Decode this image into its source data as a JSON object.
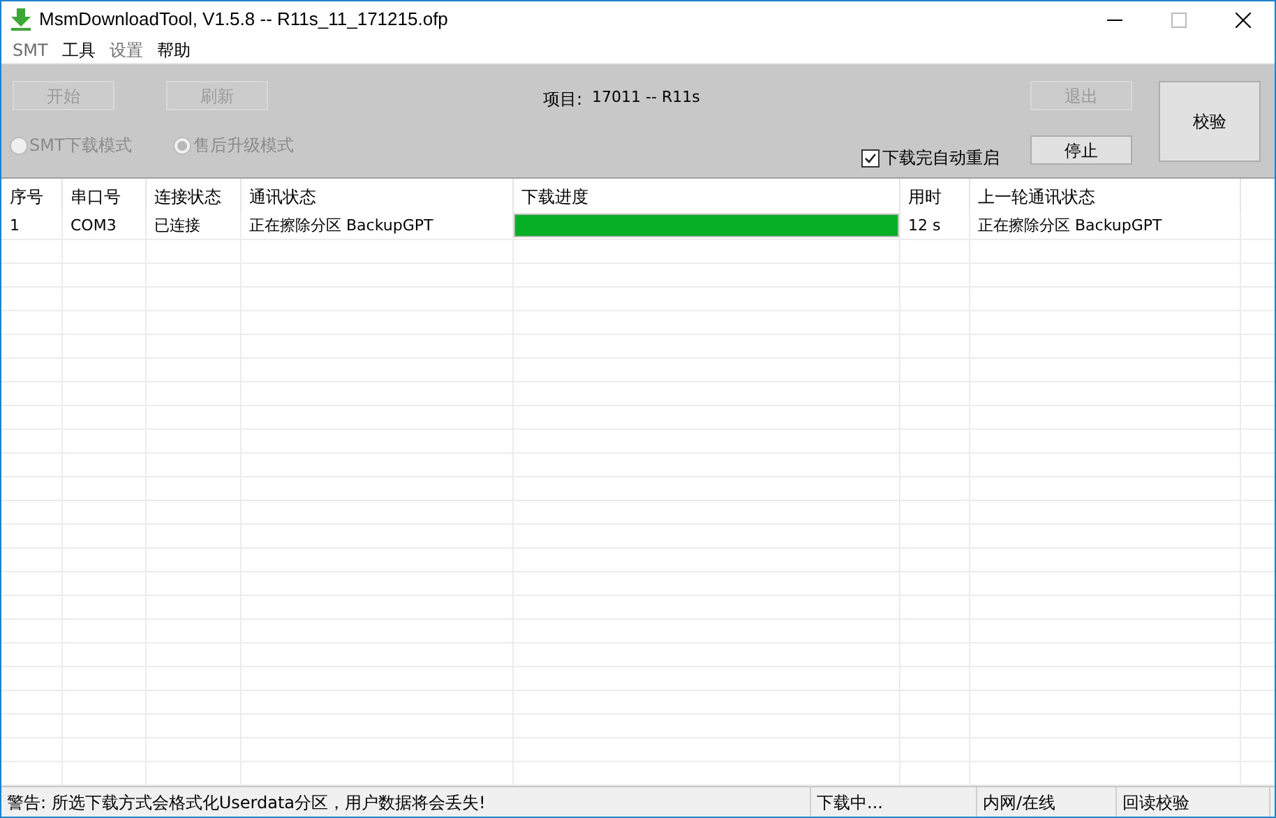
{
  "window": {
    "title": "MsmDownloadTool, V1.5.8 -- R11s_11_171215.ofp"
  },
  "menu": [
    {
      "label": "SMT",
      "disabled": true
    },
    {
      "label": "工具",
      "disabled": false
    },
    {
      "label": "设置",
      "disabled": true
    },
    {
      "label": "帮助",
      "disabled": false
    }
  ],
  "toolbar": {
    "buttons": [
      {
        "label": "开始",
        "disabled": true
      },
      {
        "label": "刷新",
        "disabled": true
      }
    ],
    "project": {
      "label": "项目:",
      "value": "17011 -- R11s"
    },
    "modes": [
      {
        "label": "SMT下载模式",
        "selected": false,
        "disabled": true
      },
      {
        "label": "售后升级模式",
        "selected": true,
        "disabled": true
      }
    ],
    "auto_reboot": {
      "label": "下载完自动重启",
      "checked": true
    },
    "exit_button": {
      "label": "退出",
      "disabled": true
    },
    "stop_button": {
      "label": "停止",
      "disabled": false
    },
    "verify_button": {
      "label": "校验",
      "disabled": false
    }
  },
  "table": {
    "columns": [
      "序号",
      "串口号",
      "连接状态",
      "通讯状态",
      "下载进度",
      "用时",
      "上一轮通讯状态"
    ],
    "rows": [
      {
        "index": "1",
        "port": "COM3",
        "connection": "已连接",
        "status": "正在擦除分区 BackupGPT",
        "level": 1,
        "time": "12 s",
        "last_status": "正在擦除分区 BackupGPT"
      }
    ]
  },
  "status_bar": [
    "警告: 所选下载方式会格式化Userdata分区，用户数据将会丢失!",
    "下载中...",
    "内网/在线",
    "回读校验"
  ]
}
